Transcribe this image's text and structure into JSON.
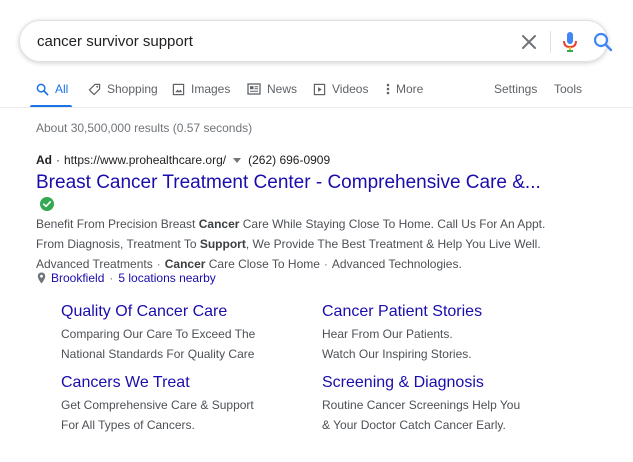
{
  "search": {
    "query": "cancer survivor support"
  },
  "tabs": [
    {
      "label": "All",
      "icon": "search-icon"
    },
    {
      "label": "Shopping",
      "icon": "tag-icon"
    },
    {
      "label": "Images",
      "icon": "image-icon"
    },
    {
      "label": "News",
      "icon": "newspaper-icon"
    },
    {
      "label": "Videos",
      "icon": "play-icon"
    },
    {
      "label": "More",
      "icon": "more-vert-icon"
    }
  ],
  "tools": {
    "settings": "Settings",
    "tools": "Tools"
  },
  "stats": "About 30,500,000 results (0.57 seconds)",
  "ad": {
    "label": "Ad",
    "separator": "·",
    "url": "https://www.prohealthcare.org/",
    "phone": "(262) 696-0909",
    "title": "Breast Cancer Treatment Center - Comprehensive Care &...",
    "description": {
      "p1": "Benefit From Precision Breast ",
      "b1": "Cancer",
      "p2": " Care While Staying Close To Home. Call Us For An Appt.",
      "p3": "From Diagnosis, Treatment To ",
      "b2": "Support",
      "p4": ", We Provide The Best Treatment & Help You Live Well.",
      "link1": "Advanced Treatments",
      "dot": "·",
      "b3": "Cancer",
      "link2_rest": " Care Close To Home",
      "link3": "Advanced Technologies."
    },
    "location": {
      "city": "Brookfield",
      "separator": "·",
      "nearby": "5 locations nearby"
    },
    "sitelinks": [
      {
        "title": "Quality Of Cancer Care",
        "line1": "Comparing Our Care To Exceed The",
        "line2": "National Standards For Quality Care"
      },
      {
        "title": "Cancer Patient Stories",
        "line1": "Hear From Our Patients.",
        "line2": "Watch Our Inspiring Stories."
      },
      {
        "title": "Cancers We Treat",
        "line1": "Get Comprehensive Care & Support",
        "line2": "For All Types of Cancers."
      },
      {
        "title": "Screening & Diagnosis",
        "line1": "Routine Cancer Screenings Help You",
        "line2": "& Your Doctor Catch Cancer Early."
      }
    ]
  },
  "colors": {
    "accent": "#1a73e8",
    "link": "#1a0dab",
    "verified": "#34a853"
  }
}
